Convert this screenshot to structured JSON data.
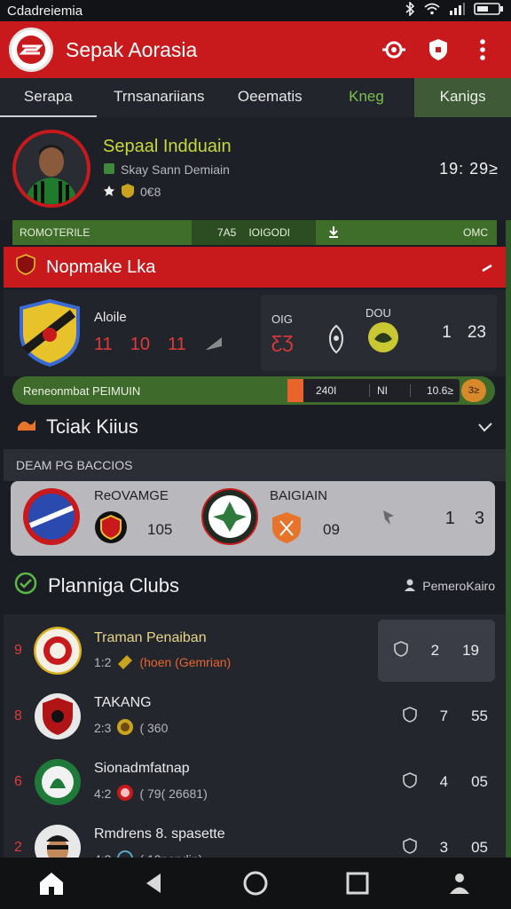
{
  "status_bar": {
    "left_text": "Cdadreiemia",
    "icons": [
      "bluetooth-icon",
      "wifi-icon",
      "signal-icon",
      "battery-icon"
    ]
  },
  "app_bar": {
    "title": "Sepak Aorasia",
    "actions": [
      "dial-icon",
      "shield-icon",
      "more-icon"
    ]
  },
  "tabs": [
    {
      "label": "Serapa"
    },
    {
      "label": "Trnsanariians"
    },
    {
      "label": "Oeematis"
    },
    {
      "label": "Kneg"
    },
    {
      "label": "Kanigs"
    }
  ],
  "profile": {
    "name": "Sepaal Indduain",
    "subtitle": "Skay Sann Demiain",
    "meta": "0€8",
    "time": "19:  29≥"
  },
  "info_strip": {
    "left": "ROMOTERILE",
    "mid_a": "7A5",
    "mid_b": "IOIGODI",
    "right": "OMC"
  },
  "featured": {
    "title": "Nopmake Lka",
    "team_name": "Aloile",
    "scores": [
      "11",
      "10",
      "11"
    ],
    "tag1": "OIG",
    "red_num": "ƸƷ",
    "tag2": "DOU",
    "right_a": "1",
    "right_b": "23"
  },
  "progress": {
    "label": "Reneonmbat PEIMUIN",
    "box_a": "240I",
    "box_b": "NI",
    "box_c": "10.6≥",
    "badge": "3≥"
  },
  "section_track": {
    "title": "Tciak Kiius",
    "subheader": "DEAM PG BACCIOS"
  },
  "group_card": {
    "team_a": "ReOVAMGE",
    "num_a": "105",
    "team_b": "BAIGIAIN",
    "num_b": "09",
    "stat_a": "1",
    "stat_b": "3"
  },
  "section_clubs": {
    "title": "Planniga Clubs",
    "action": "PemeroKairo"
  },
  "clubs": [
    {
      "rank": "9",
      "name": "Traman Penaiban",
      "sub_a": "1:2",
      "sub_b": "(hoen (Gemrian)",
      "stat_a": "2",
      "stat_b": "19"
    },
    {
      "rank": "8",
      "name": "TAKANG",
      "sub_a": "2:3",
      "sub_b": "( 360",
      "stat_a": "7",
      "stat_b": "55"
    },
    {
      "rank": "6",
      "name": "Sionadmfatnap",
      "sub_a": "4:2",
      "sub_b": "( 79( 26681)",
      "stat_a": "4",
      "stat_b": "05"
    },
    {
      "rank": "2",
      "name": "Rmdrens 8. spasette",
      "sub_a": "4:3",
      "sub_b": "( 10pandin)",
      "stat_a": "3",
      "stat_b": "05"
    }
  ],
  "colors": {
    "primary_red": "#c81a1c",
    "accent_green": "#3e6a2c",
    "name_yellow": "#c7d83a"
  }
}
